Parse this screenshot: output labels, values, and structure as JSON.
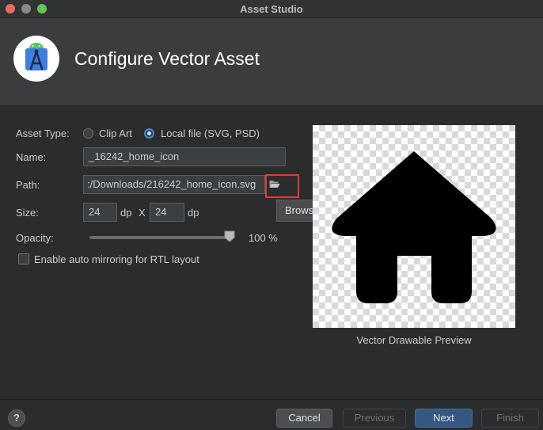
{
  "window": {
    "title": "Asset Studio"
  },
  "header": {
    "title": "Configure Vector Asset"
  },
  "form": {
    "asset_type_label": "Asset Type:",
    "asset_type_options": [
      "Clip Art",
      "Local file (SVG, PSD)"
    ],
    "asset_type_selected": "Local file (SVG, PSD)",
    "name_label": "Name:",
    "name_value": "_16242_home_icon",
    "path_label": "Path:",
    "path_value": ":/Downloads/216242_home_icon.svg",
    "browse_tooltip": "Browse... (⇧↩)",
    "size_label": "Size:",
    "width_value": "24",
    "height_value": "24",
    "unit": "dp",
    "size_separator": "X",
    "opacity_label": "Opacity:",
    "opacity_value": "100 %",
    "opacity_fraction": 1.0,
    "rtl_label": "Enable auto mirroring for RTL layout",
    "rtl_checked": false
  },
  "preview": {
    "caption": "Vector Drawable Preview",
    "icon": "home-icon"
  },
  "footer": {
    "help_label": "?",
    "cancel_label": "Cancel",
    "previous_label": "Previous",
    "next_label": "Next",
    "finish_label": "Finish"
  },
  "colors": {
    "accent": "#3e88d6",
    "highlight_box": "#e53935",
    "next_button": "#365880"
  }
}
